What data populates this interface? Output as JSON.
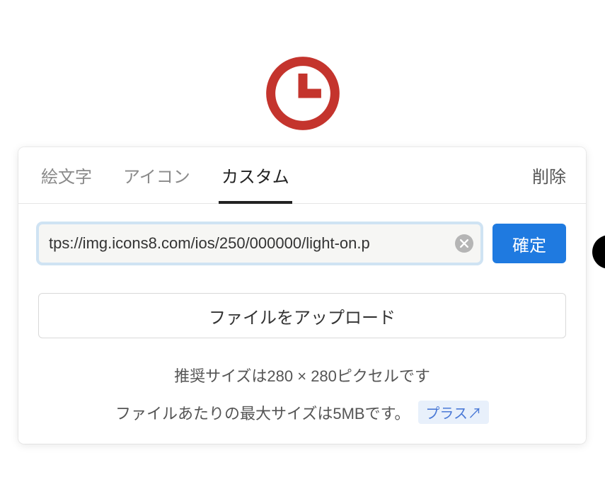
{
  "icon": {
    "color": "#c4342d"
  },
  "tabs": {
    "emoji": "絵文字",
    "icon": "アイコン",
    "custom": "カスタム",
    "active": "custom"
  },
  "delete_label": "削除",
  "url_input": {
    "value": "tps://img.icons8.com/ios/250/000000/light-on.p",
    "placeholder": ""
  },
  "confirm_label": "確定",
  "upload_label": "ファイルをアップロード",
  "hints": {
    "recommended": "推奨サイズは280 × 280ピクセルです",
    "max_size": "ファイルあたりの最大サイズは5MBです。",
    "plus": "プラス↗"
  },
  "colors": {
    "accent": "#1f7ae0",
    "icon_red": "#c4342d",
    "plus_bg": "#e8f0fb",
    "plus_fg": "#4a79d6"
  }
}
